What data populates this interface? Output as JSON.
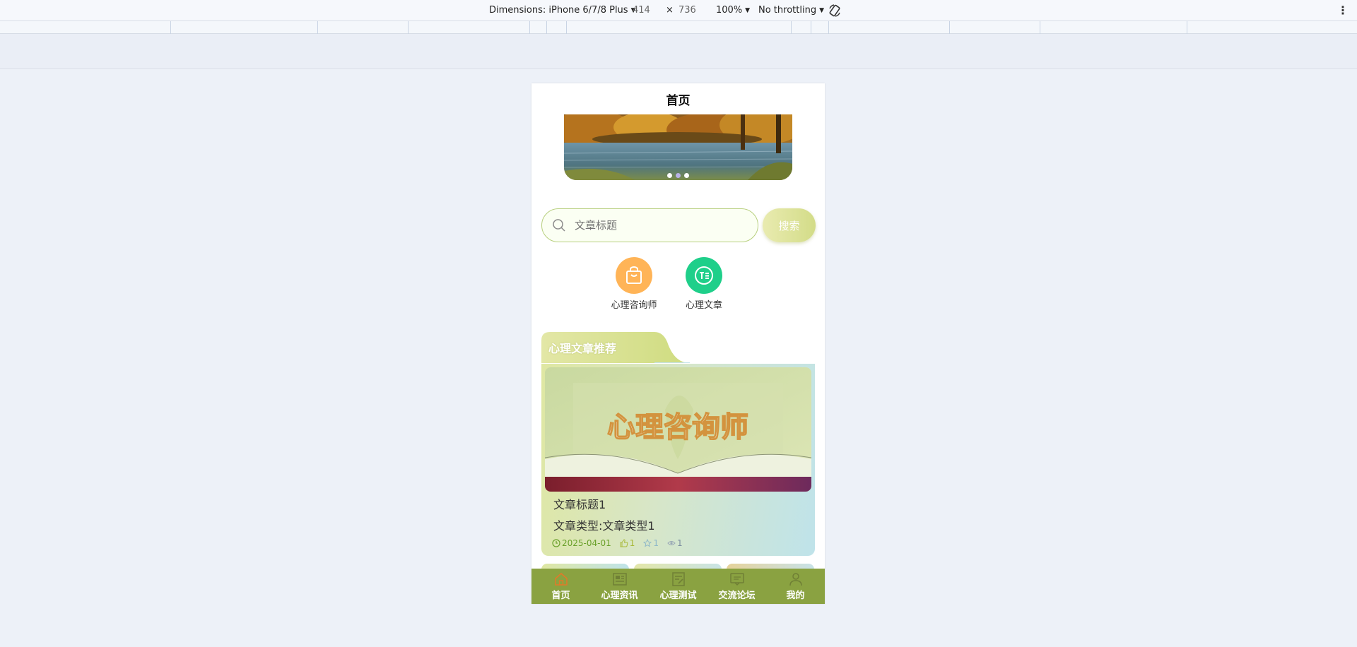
{
  "devtools": {
    "dimensions_label": "Dimensions: iPhone 6/7/8 Plus",
    "width": "414",
    "times": "×",
    "height": "736",
    "zoom": "100%",
    "throttle": "No throttling"
  },
  "page": {
    "title": "首页"
  },
  "banner": {
    "slide_count": 3,
    "active_index": 1
  },
  "search": {
    "placeholder": "文章标题",
    "button_label": "搜索"
  },
  "categories": [
    {
      "label": "心理咨询师",
      "icon": "shopping-bag-icon",
      "color": "#ffb457"
    },
    {
      "label": "心理文章",
      "icon": "article-text-icon",
      "color": "#1fcf8a"
    }
  ],
  "recommend": {
    "section_title": "心理文章推荐",
    "card": {
      "image_text": "心理咨询师",
      "title": "文章标题1",
      "type_label": "文章类型:文章类型1",
      "date": "2025-04-01",
      "likes": "1",
      "favorites": "1",
      "views": "1"
    }
  },
  "tabbar": {
    "items": [
      {
        "label": "首页",
        "icon": "home-icon",
        "active": true
      },
      {
        "label": "心理资讯",
        "icon": "news-icon",
        "active": false
      },
      {
        "label": "心理测试",
        "icon": "test-icon",
        "active": false
      },
      {
        "label": "交流论坛",
        "icon": "forum-icon",
        "active": false
      },
      {
        "label": "我的",
        "icon": "user-icon",
        "active": false
      }
    ]
  },
  "colors": {
    "accent_green": "#8aa241",
    "search_border": "#b7cf7e",
    "active_tab_icon": "#e07a2a"
  }
}
